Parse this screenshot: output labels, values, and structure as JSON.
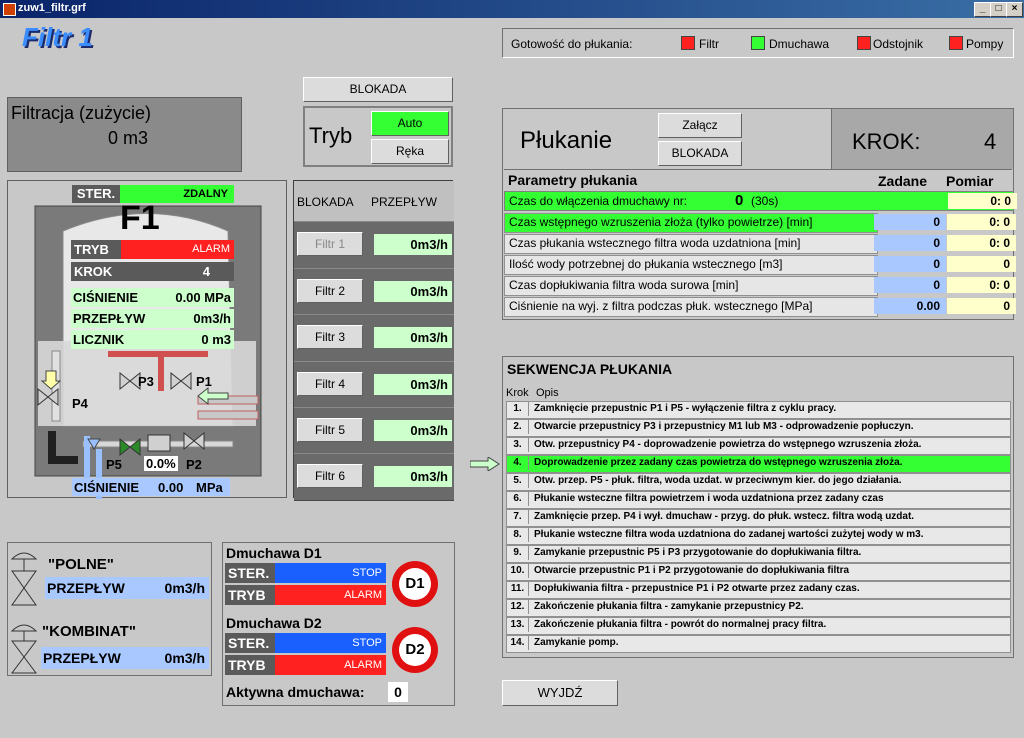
{
  "window": {
    "title": "zuw1_filtr.grf",
    "min": "_",
    "max": "□",
    "close": "×"
  },
  "header": {
    "title": "Filtr 1"
  },
  "readiness": {
    "label": "Gotowość do płukania:",
    "items": [
      {
        "label": "Filtr",
        "color": "#ff2020"
      },
      {
        "label": "Dmuchawa",
        "color": "#33ff33"
      },
      {
        "label": "Odstojnik",
        "color": "#ff2020"
      },
      {
        "label": "Pompy",
        "color": "#ff2020"
      }
    ]
  },
  "blokada_top": "BLOKADA",
  "tryb": {
    "label": "Tryb",
    "auto": "Auto",
    "reka": "Ręka"
  },
  "filtracja": {
    "title": "Filtracja (zużycie)",
    "value": "0  m3"
  },
  "filter": {
    "ster_label": "STER.",
    "ster_value": "ZDALNY",
    "name": "F1",
    "tryb_label": "TRYB",
    "tryb_value": "ALARM",
    "krok_label": "KROK",
    "krok_value": "4",
    "cisnienie_label": "CIŚNIENIE",
    "cisnienie_value": "0.00 MPa",
    "przeplyw_label": "PRZEPŁYW",
    "przeplyw_value": "0m3/h",
    "licznik_label": "LICZNIK",
    "licznik_value": "0 m3",
    "p1": "P1",
    "p2": "P2",
    "p3": "P3",
    "p4": "P4",
    "p5": "P5",
    "pct": "0.0%",
    "bottom_label": "CIŚNIENIE",
    "bottom_value": "0.00",
    "bottom_unit": "MPa"
  },
  "filters_table": {
    "h1": "BLOKADA",
    "h2": "PRZEPŁYW",
    "rows": [
      {
        "label": "Filtr 1",
        "value": "0m3/h",
        "disabled": true
      },
      {
        "label": "Filtr 2",
        "value": "0m3/h"
      },
      {
        "label": "Filtr 3",
        "value": "0m3/h"
      },
      {
        "label": "Filtr 4",
        "value": "0m3/h"
      },
      {
        "label": "Filtr 5",
        "value": "0m3/h"
      },
      {
        "label": "Filtr 6",
        "value": "0m3/h"
      }
    ]
  },
  "plukanie": {
    "title": "Płukanie",
    "zalacz": "Załącz",
    "blokada": "BLOKADA",
    "krok_label": "KROK:",
    "krok_value": "4"
  },
  "params": {
    "title": "Parametry płukania",
    "zadane": "Zadane",
    "pomiar": "Pomiar",
    "row0": {
      "label": "Czas do włączenia dmuchawy nr:",
      "num": "0",
      "extra": "(30s)",
      "pomiar": "0:  0"
    },
    "rows": [
      {
        "label": "Czas wstępnego wzruszenia złoża (tylko powietrze) [min]",
        "zadane": "0",
        "pomiar": "0:  0",
        "hl": true
      },
      {
        "label": "Czas płukania wstecznego filtra woda uzdatniona  [min]",
        "zadane": "0",
        "pomiar": "0:  0"
      },
      {
        "label": "Ilość wody potrzebnej do płukania wstecznego  [m3]",
        "zadane": "0",
        "pomiar": "0"
      },
      {
        "label": "Czas dopłukiwania filtra woda surowa  [min]",
        "zadane": "0",
        "pomiar": "0:  0"
      },
      {
        "label": "Ciśnienie na wyj. z filtra podczas płuk. wstecznego [MPa]",
        "zadane": "0.00",
        "pomiar": "0"
      }
    ]
  },
  "sequence": {
    "title": "SEKWENCJA PŁUKANIA",
    "col_krok": "Krok",
    "col_opis": "Opis",
    "active": 4,
    "rows": [
      {
        "n": "1.",
        "d": "Zamknięcie przepustnic P1 i P5 - wyłączenie filtra z cyklu pracy."
      },
      {
        "n": "2.",
        "d": "Otwarcie przepustnicy P3 i przepustnicy M1 lub M3 - odprowadzenie popłuczyn."
      },
      {
        "n": "3.",
        "d": "Otw. przepustnicy P4 - doprowadzenie powietrza do wstępnego wzruszenia złoża."
      },
      {
        "n": "4.",
        "d": "Doprowadzenie przez zadany czas powietrza do wstępnego wzruszenia złoża."
      },
      {
        "n": "5.",
        "d": "Otw. przep. P5 - płuk. filtra, woda uzdat. w przeciwnym kier. do jego działania."
      },
      {
        "n": "6.",
        "d": "Płukanie wsteczne filtra powietrzem i woda uzdatniona przez zadany czas"
      },
      {
        "n": "7.",
        "d": "Zamknięcie przep. P4 i wył. dmuchaw - przyg. do płuk. wstecz. filtra wodą uzdat."
      },
      {
        "n": "8.",
        "d": "Płukanie wsteczne filtra woda uzdatniona do zadanej wartości zużytej wody w m3."
      },
      {
        "n": "9.",
        "d": "Zamykanie przepustnic P5 i P3 przygotowanie do dopłukiwania filtra."
      },
      {
        "n": "10.",
        "d": "Otwarcie przepustnic P1 i P2  przygotowanie do dopłukiwania filtra"
      },
      {
        "n": "11.",
        "d": "Dopłukiwania filtra - przepustnice P1 i P2  otwarte przez zadany czas."
      },
      {
        "n": "12.",
        "d": "Zakończenie płukania filtra - zamykanie przepustnicy P2."
      },
      {
        "n": "13.",
        "d": "Zakończenie płukania filtra - powrót do normalnej pracy filtra."
      },
      {
        "n": "14.",
        "d": "Zamykanie pomp."
      }
    ]
  },
  "flows": {
    "polne": {
      "title": "\"POLNE\"",
      "label": "PRZEPŁYW",
      "value": "0m3/h"
    },
    "kombinat": {
      "title": "\"KOMBINAT\"",
      "label": "PRZEPŁYW",
      "value": "0m3/h"
    }
  },
  "blowers": {
    "d1": {
      "title": "Dmuchawa D1",
      "ster": "STER.",
      "ster_value": "STOP",
      "tryb": "TRYB",
      "tryb_value": "ALARM",
      "badge": "D1"
    },
    "d2": {
      "title": "Dmuchawa D2",
      "ster": "STER.",
      "ster_value": "STOP",
      "tryb": "TRYB",
      "tryb_value": "ALARM",
      "badge": "D2"
    },
    "active_label": "Aktywna dmuchawa:",
    "active_value": "0"
  },
  "exit": "WYJDŹ"
}
